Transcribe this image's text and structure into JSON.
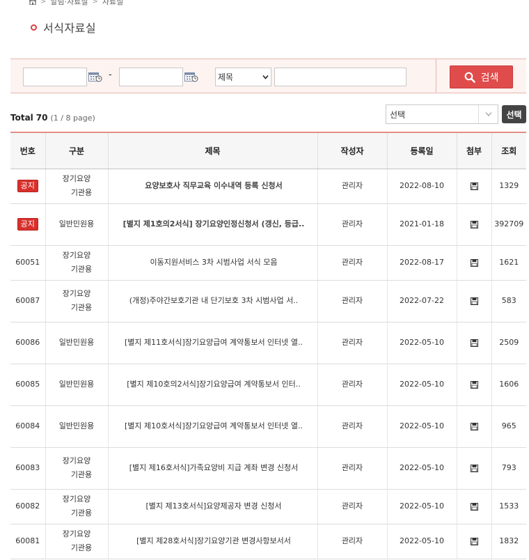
{
  "breadcrumb": {
    "items": [
      "알림·자료실",
      "자료실"
    ]
  },
  "page": {
    "title": "서식자료실"
  },
  "search": {
    "date_separator": "-",
    "field_selected": "제목",
    "button_label": "검색"
  },
  "listing": {
    "total_label": "Total",
    "total_count": "70",
    "page_info": "(1 / 8 page)",
    "category_selected": "선택",
    "choose_button": "선택"
  },
  "table": {
    "headers": [
      "번호",
      "구분",
      "제목",
      "작성자",
      "등록일",
      "첨부",
      "조회"
    ],
    "rows": [
      {
        "no": "공지",
        "notice": true,
        "category": "장기요양\n기관용",
        "title": "요양보호사 직무교육 이수내역 등록 신청서",
        "author": "관리자",
        "date": "2022-08-10",
        "views": "1329"
      },
      {
        "no": "공지",
        "notice": true,
        "category": "일반민원용",
        "title": "[별지 제1호의2서식] 장기요양인정신청서 (갱신, 등급..",
        "author": "관리자",
        "date": "2021-01-18",
        "views": "392709"
      },
      {
        "no": "60051",
        "notice": false,
        "category": "장기요양\n기관용",
        "title": "이동지원서비스 3차 시범사업 서식 모음",
        "author": "관리자",
        "date": "2022-08-17",
        "views": "1621"
      },
      {
        "no": "60087",
        "notice": false,
        "category": "장기요양\n기관용",
        "title": "(개정)주야간보호기관 내 단기보호 3차 시범사업 서..",
        "author": "관리자",
        "date": "2022-07-22",
        "views": "583"
      },
      {
        "no": "60086",
        "notice": false,
        "category": "일반민원용",
        "title": "[별지 제11호서식]장기요양급여 계약통보서 인터넷 열..",
        "author": "관리자",
        "date": "2022-05-10",
        "views": "2509"
      },
      {
        "no": "60085",
        "notice": false,
        "category": "일반민원용",
        "title": "[별지 제10호의2서식]장기요양급여 계약통보서 인터..",
        "author": "관리자",
        "date": "2022-05-10",
        "views": "1606"
      },
      {
        "no": "60084",
        "notice": false,
        "category": "일반민원용",
        "title": "[별지 제10호서식]장기요양급여 계약통보서 인터넷 열..",
        "author": "관리자",
        "date": "2022-05-10",
        "views": "965"
      },
      {
        "no": "60083",
        "notice": false,
        "category": "장기요양\n기관용",
        "title": "[별지 제16호서식]가족요양비 지급 계좌 변경 신청서",
        "author": "관리자",
        "date": "2022-05-10",
        "views": "793"
      },
      {
        "no": "60082",
        "notice": false,
        "category": "장기요양\n기관용",
        "title": "[별지 제13호서식]요양제공자 변경 신청서",
        "author": "관리자",
        "date": "2022-05-10",
        "views": "1533"
      },
      {
        "no": "60081",
        "notice": false,
        "category": "장기요양\n기관용",
        "title": "[별지 제28호서식]장기요양기관 변경사항보서서",
        "author": "관리자",
        "date": "2022-05-10",
        "views": "1832"
      }
    ]
  },
  "colors": {
    "accent": "#e04c4c",
    "notice_badge": "#d9302c",
    "search_bg": "#fdf3f1"
  },
  "icons": {
    "home": "home-icon",
    "calendar": "calendar-icon",
    "search": "search-icon",
    "file": "floppy-disk-icon"
  }
}
